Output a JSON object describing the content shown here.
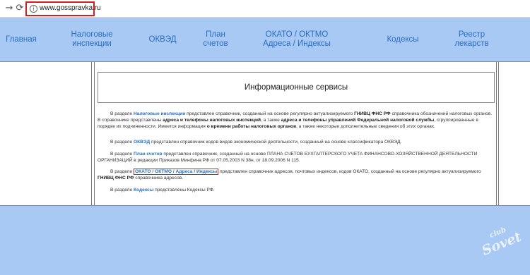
{
  "browser": {
    "back_icon": "→",
    "reload_icon": "⟳",
    "info_icon": "i",
    "url": "www.gosspravka.ru"
  },
  "nav": [
    {
      "label": "Главная"
    },
    {
      "label": "Налоговые\nинспекции"
    },
    {
      "label": "ОКВЭД"
    },
    {
      "label": "План\nсчетов"
    },
    {
      "label": "ОКАТО / ОКТМО\nАдреса / Индексы"
    },
    {
      "label": "Кодексы"
    },
    {
      "label": "Реестр\nлекарств"
    }
  ],
  "page_title": "Информационные сервисы",
  "paragraphs": {
    "p1": {
      "prefix": "В разделе ",
      "link": "Налоговые инспекции",
      "t1": " представлен справочник, созданный на основе регулярно актуализируемого ",
      "b1": "ГНИВЦ ФНС РФ",
      "t2": " справочника обозначений налоговых органов. В справочнике представлены ",
      "b2": "адреса и телефоны налоговых инспекций",
      "t3": ", а также ",
      "b3": "адреса и телефоны управлений Федеральной налоговой службы",
      "t4": ", сгруппированные в порядке их подчиненности. Имеется информация ",
      "b4": "о времени работы налоговых органов",
      "t5": ", а также некоторые дополнительные сведения об этих органах."
    },
    "p2": {
      "prefix": "В разделе ",
      "link": "ОКВЭД",
      "text": " представлен справочник кодов видов экономической деятельности, созданный на основе классификатора ОКВЭД."
    },
    "p3": {
      "prefix": "В разделе ",
      "link": "План счетов",
      "text": " представлен справочник, созданный на основе ПЛАНА СЧЕТОВ БУХГАЛТЕРСКОГО УЧЕТА ФИНАНСОВО-ХОЗЯЙСТВЕННОЙ ДЕЯТЕЛЬНОСТИ ОРГАНИЗАЦИЙ в редакции Приказов Минфина РФ от 07.05.2003 N 38н, от 18.09.2006 N 115."
    },
    "p4": {
      "prefix": "В разделе ",
      "link": "ОКАТО / ОКТМО / Адреса / Индексы",
      "t1": " представлен справочник адресов, почтовых индексов, кодов ОКАТО, созданный на основе регулярно актуализируемого ",
      "b1": "ГНИВЦ ФНС РФ",
      "t2": " справочника адресов."
    },
    "p5": {
      "prefix": "В разделе ",
      "link": "Кодексы",
      "text": " представлены Кодексы РФ."
    }
  },
  "watermark": {
    "line1": "club",
    "line2": "Sovet"
  },
  "colors": {
    "accent": "#2a6dc5",
    "nav_bg": "#a7c9f4",
    "highlight": "#d21f1f"
  }
}
